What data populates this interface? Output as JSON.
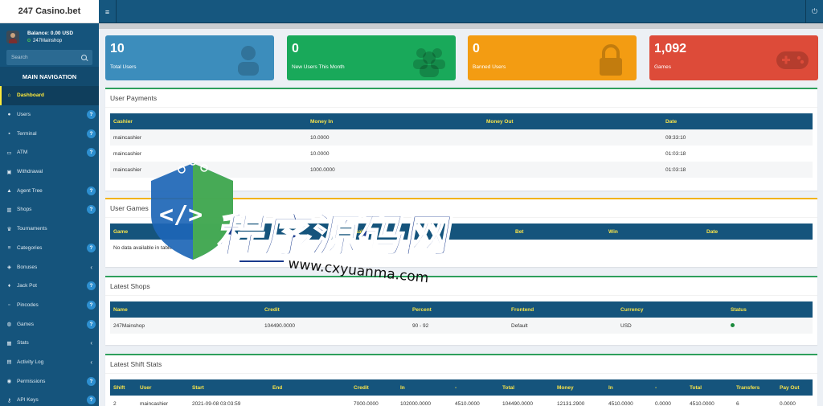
{
  "app": {
    "title": "247 Casino.bet"
  },
  "user": {
    "balance": "Balance: 0.00 USD",
    "shop": "247Mainshop"
  },
  "search": {
    "placeholder": "Search"
  },
  "nav": {
    "header": "MAIN NAVIGATION",
    "items": [
      {
        "label": "Dashboard",
        "icon": "home-icon",
        "glyph": "⌂",
        "badge": "",
        "chevron": false,
        "active": true
      },
      {
        "label": "Users",
        "icon": "user-icon",
        "glyph": "●",
        "badge": "?",
        "chevron": false
      },
      {
        "label": "Terminal",
        "icon": "terminal-icon",
        "glyph": "▪",
        "badge": "?",
        "chevron": false
      },
      {
        "label": "ATM",
        "icon": "atm-icon",
        "glyph": "▭",
        "badge": "?",
        "chevron": false
      },
      {
        "label": "Withdrawal",
        "icon": "withdrawal-icon",
        "glyph": "▣",
        "badge": "",
        "chevron": false
      },
      {
        "label": "Agent Tree",
        "icon": "agent-tree-icon",
        "glyph": "▲",
        "badge": "?",
        "chevron": false
      },
      {
        "label": "Shops",
        "icon": "shop-icon",
        "glyph": "▥",
        "badge": "?",
        "chevron": false
      },
      {
        "label": "Tournaments",
        "icon": "trophy-icon",
        "glyph": "♛",
        "badge": "",
        "chevron": false
      },
      {
        "label": "Categories",
        "icon": "categories-icon",
        "glyph": "≡",
        "badge": "?",
        "chevron": false
      },
      {
        "label": "Bonuses",
        "icon": "bonus-icon",
        "glyph": "◈",
        "badge": "",
        "chevron": true
      },
      {
        "label": "Jack Pot",
        "icon": "jackpot-icon",
        "glyph": "♦",
        "badge": "?",
        "chevron": false
      },
      {
        "label": "Pincodes",
        "icon": "pincode-icon",
        "glyph": "▫",
        "badge": "?",
        "chevron": false
      },
      {
        "label": "Games",
        "icon": "gamepad-icon",
        "glyph": "◍",
        "badge": "?",
        "chevron": false
      },
      {
        "label": "Stats",
        "icon": "stats-icon",
        "glyph": "▦",
        "badge": "",
        "chevron": true
      },
      {
        "label": "Activity Log",
        "icon": "activity-icon",
        "glyph": "▤",
        "badge": "",
        "chevron": true
      },
      {
        "label": "Permissions",
        "icon": "permissions-icon",
        "glyph": "◉",
        "badge": "?",
        "chevron": false
      },
      {
        "label": "API Keys",
        "icon": "key-icon",
        "glyph": "⚷",
        "badge": "?",
        "chevron": false
      }
    ]
  },
  "topbar": {
    "menu_glyph": "≡",
    "power_glyph": "⏻"
  },
  "stats": [
    {
      "value": "10",
      "label": "Total Users",
      "icon": "user-icon",
      "color": "#3c8dbc"
    },
    {
      "value": "0",
      "label": "New Users This Month",
      "icon": "users-group-icon",
      "color": "#19a95a"
    },
    {
      "value": "0",
      "label": "Banned Users",
      "icon": "lock-icon",
      "color": "#f39c12"
    },
    {
      "value": "1,092",
      "label": "Games",
      "icon": "gamepad-icon",
      "color": "#dd4b39"
    }
  ],
  "payments": {
    "title": "User Payments",
    "columns": [
      "Cashier",
      "Money In",
      "Money Out",
      "Date"
    ],
    "rows": [
      [
        "maincashier",
        "10.0000",
        "",
        "09:33:10"
      ],
      [
        "maincashier",
        "10.0000",
        "",
        "01:03:18"
      ],
      [
        "maincashier",
        "1000.0000",
        "",
        "01:03:18"
      ]
    ]
  },
  "games": {
    "title": "User Games",
    "columns": [
      "Game",
      "Balance",
      "Bet",
      "Win",
      "Date"
    ],
    "empty": "No data available in table"
  },
  "shops": {
    "title": "Latest Shops",
    "columns": [
      "Name",
      "Credit",
      "Percent",
      "Frontend",
      "Currency",
      "Status"
    ],
    "rows": [
      [
        "247Mainshop",
        "104490.0000",
        "90 - 92",
        "Default",
        "USD",
        ""
      ]
    ]
  },
  "shifts": {
    "title": "Latest Shift Stats",
    "columns": [
      "Shift",
      "User",
      "Start",
      "End",
      "Credit",
      "In",
      "-",
      "Total",
      "Money",
      "In",
      "-",
      "Total",
      "Transfers",
      "Pay Out"
    ],
    "rows": [
      [
        "2",
        "maincashier",
        "2021-09-08 03:03:59",
        "",
        "7000.0000",
        "102000.0000",
        "4510.0000",
        "104490.0000",
        "12131.2900",
        "4510.0000",
        "0.0000",
        "4510.0000",
        "6",
        "0.0000"
      ]
    ]
  },
  "watermark": {
    "text_cn": "程序源码网",
    "url": "www.cxyuanma.com"
  }
}
